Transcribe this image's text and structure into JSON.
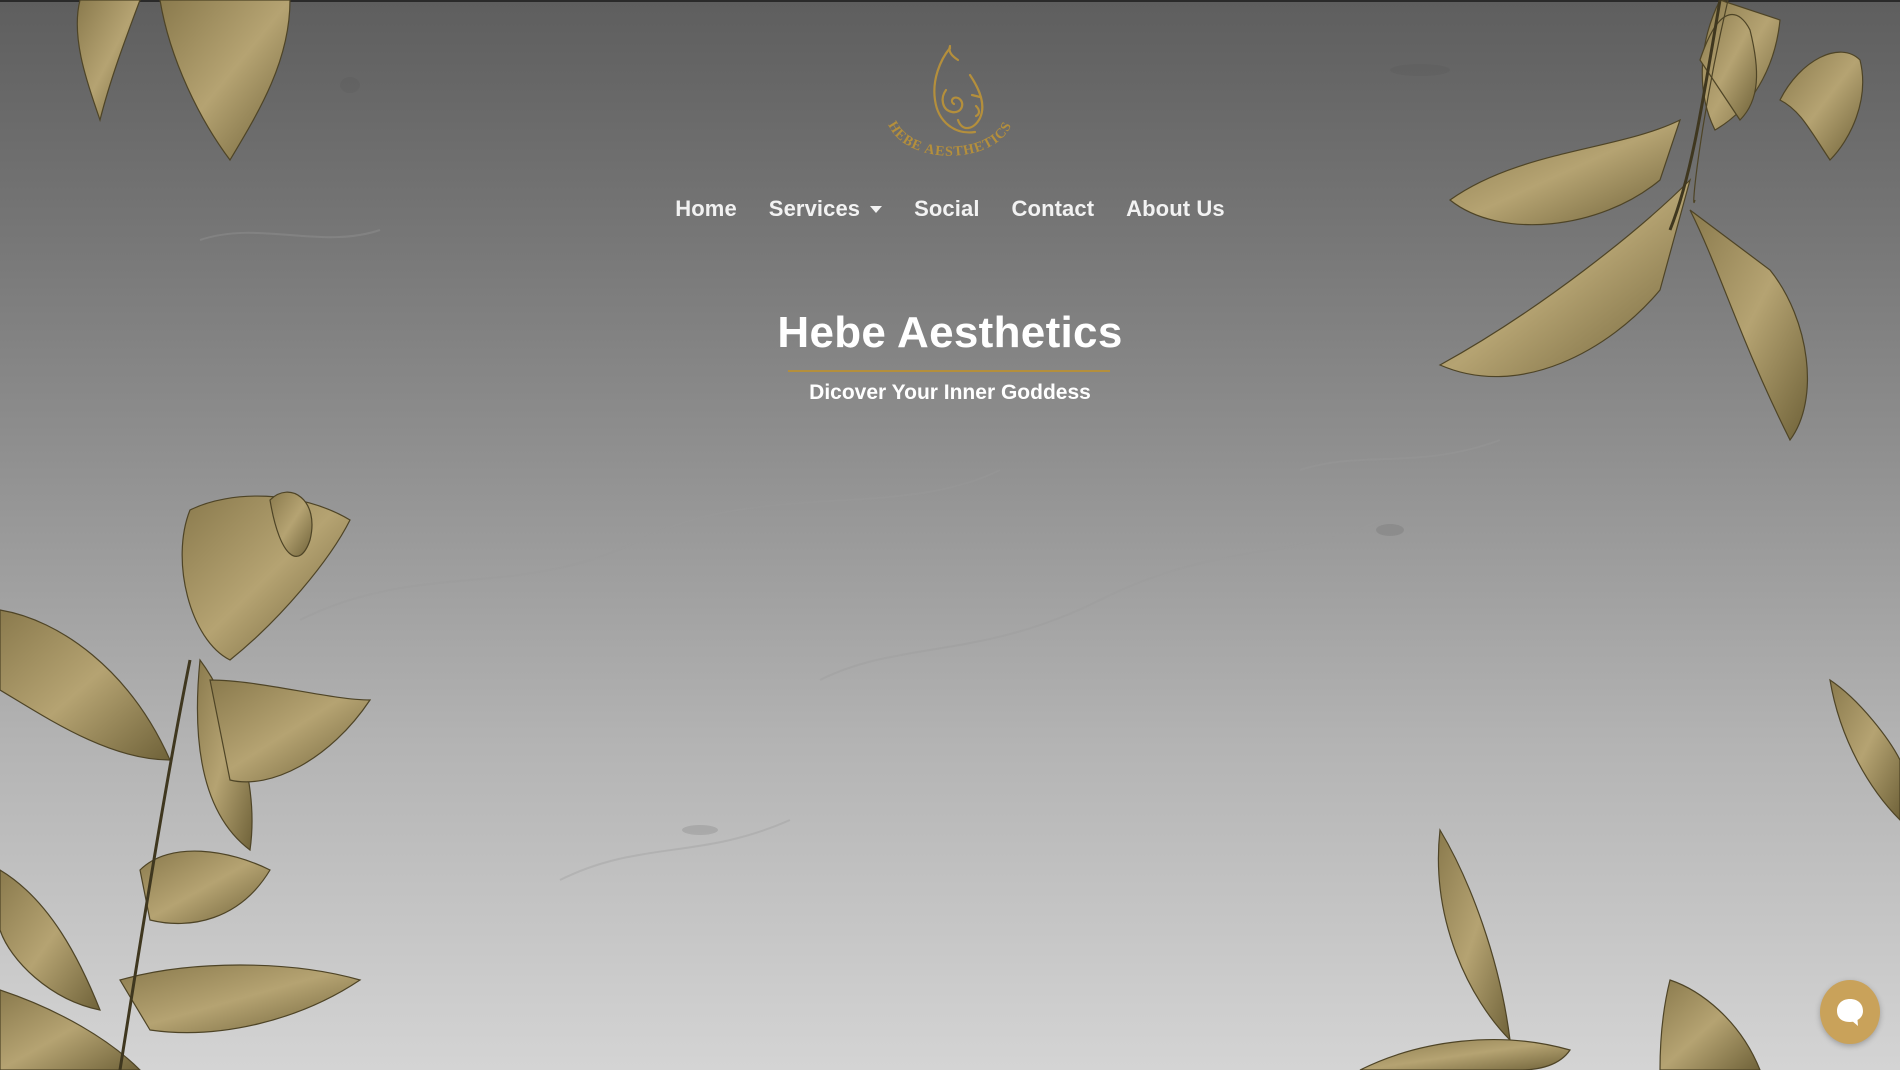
{
  "brand": {
    "logo_text": "HEBE AESTHETICS",
    "logo_alt": "Hebe Aesthetics logo"
  },
  "nav": {
    "items": [
      {
        "label": "Home"
      },
      {
        "label": "Services",
        "has_dropdown": true
      },
      {
        "label": "Social"
      },
      {
        "label": "Contact"
      },
      {
        "label": "About Us"
      }
    ]
  },
  "hero": {
    "title": "Hebe Aesthetics",
    "subtitle": "Dicover Your Inner Goddess"
  },
  "chat": {
    "icon": "chat-bubble-icon"
  },
  "colors": {
    "accent_gold": "#b48f3c",
    "leaf_gold": "#a8955f",
    "chat_gold": "#c9a25a"
  }
}
